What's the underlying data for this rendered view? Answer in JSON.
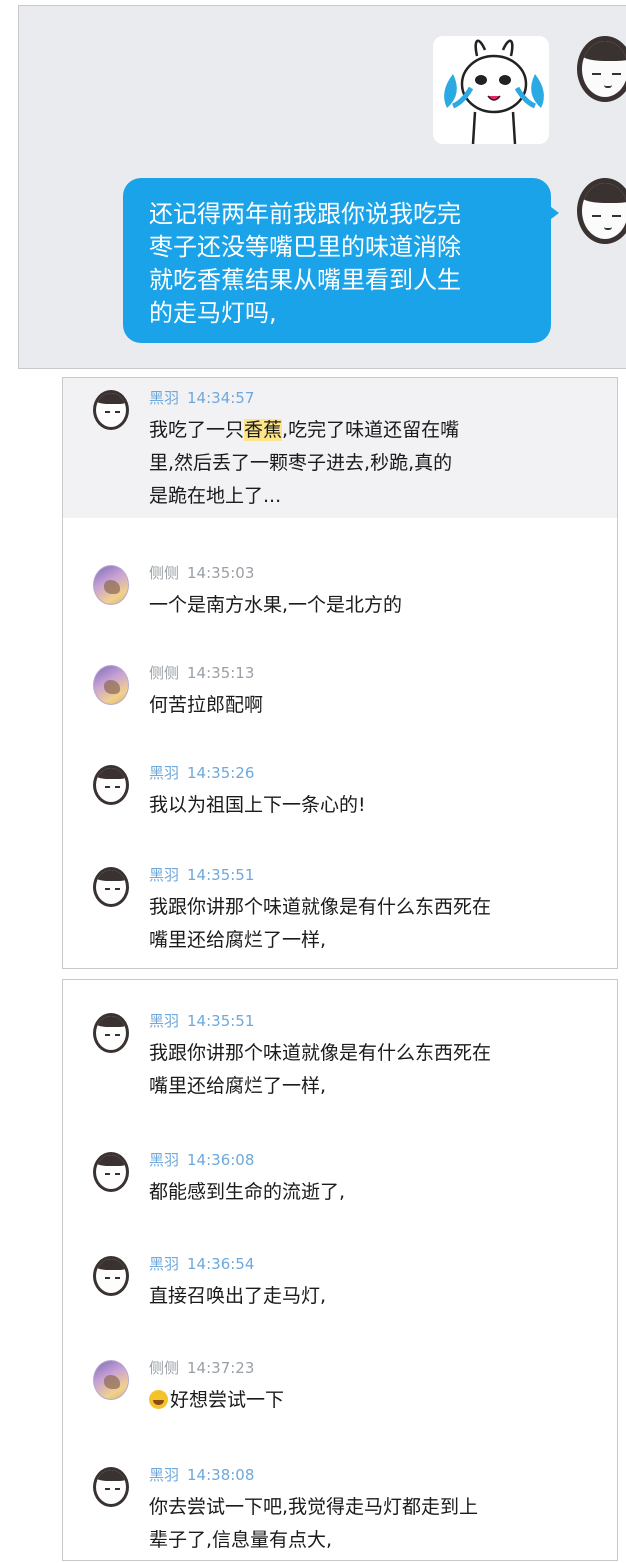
{
  "panel1": {
    "bubble_lines": [
      "还记得两年前我跟你说我吃完",
      "枣子还没等嘴巴里的味道消除",
      "就吃香蕉结果从嘴里看到人生",
      "的走马灯吗,"
    ]
  },
  "panel2": {
    "messages": [
      {
        "name": "黑羽",
        "time": "14:34:57",
        "lines": [
          "我吃了一只",
          "香蕉",
          ",吃完了味道还留在嘴",
          "里,然后丢了一颗枣子进去,秒跪,真的",
          "是跪在地上了..."
        ]
      },
      {
        "name": "侧侧",
        "time": "14:35:03",
        "lines": [
          "一个是南方水果,一个是北方的"
        ]
      },
      {
        "name": "侧侧",
        "time": "14:35:13",
        "lines": [
          "何苦拉郎配啊"
        ]
      },
      {
        "name": "黑羽",
        "time": "14:35:26",
        "lines": [
          "我以为祖国上下一条心的!"
        ]
      },
      {
        "name": "黑羽",
        "time": "14:35:51",
        "lines": [
          "我跟你讲那个味道就像是有什么东西死在",
          "嘴里还给腐烂了一样,"
        ]
      }
    ]
  },
  "panel3": {
    "messages": [
      {
        "name": "黑羽",
        "time": "14:35:51",
        "lines": [
          "我跟你讲那个味道就像是有什么东西死在",
          "嘴里还给腐烂了一样,"
        ]
      },
      {
        "name": "黑羽",
        "time": "14:36:08",
        "lines": [
          "都能感到生命的流逝了,"
        ]
      },
      {
        "name": "黑羽",
        "time": "14:36:54",
        "lines": [
          "直接召唤出了走马灯,"
        ]
      },
      {
        "name": "侧侧",
        "time": "14:37:23",
        "lines": [
          "好想尝试一下"
        ]
      },
      {
        "name": "黑羽",
        "time": "14:38:08",
        "lines": [
          "你去尝试一下吧,我觉得走马灯都走到上",
          "辈子了,信息量有点大,"
        ]
      }
    ]
  }
}
